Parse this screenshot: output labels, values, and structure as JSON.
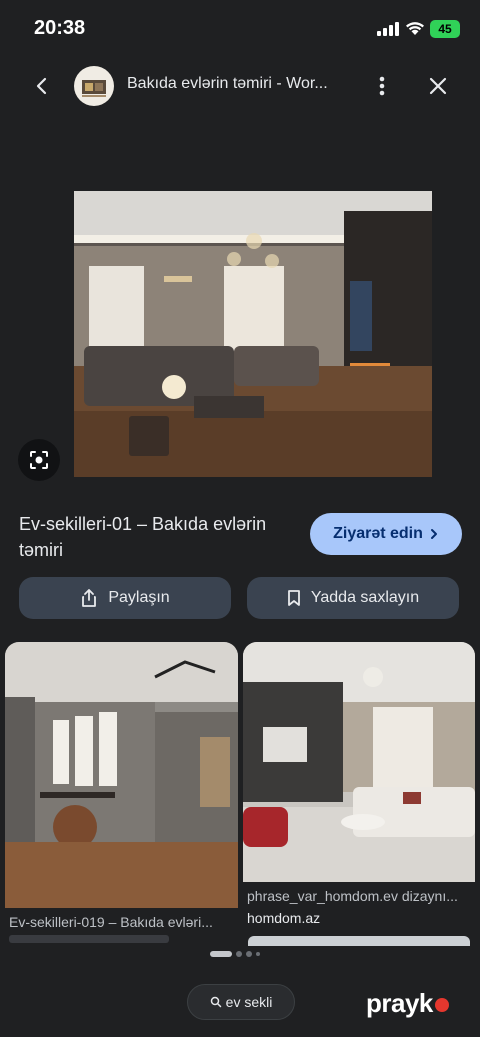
{
  "status": {
    "time": "20:38",
    "battery": "45"
  },
  "top_bar": {
    "title": "Bakıda evlərin təmiri - Wor..."
  },
  "result": {
    "title": "Ev-sekilleri-01 – Bakıda evlərin təmiri",
    "visit_label": "Ziyarət edin"
  },
  "actions": {
    "share_label": "Paylaşın",
    "save_label": "Yadda saxlayın"
  },
  "related": [
    {
      "caption": "Ev-sekilleri-019 – Bakıda evləri..."
    },
    {
      "caption": "phrase_var_homdom.ev dizaynı...",
      "source": "homdom.az"
    }
  ],
  "search": {
    "query": "ev sekli"
  },
  "watermark": {
    "text": "prayk"
  },
  "colors": {
    "accent": "#a8c7fa",
    "background": "#1f2022",
    "button": "#3a4350",
    "watermark_dot": "#e5372e"
  }
}
